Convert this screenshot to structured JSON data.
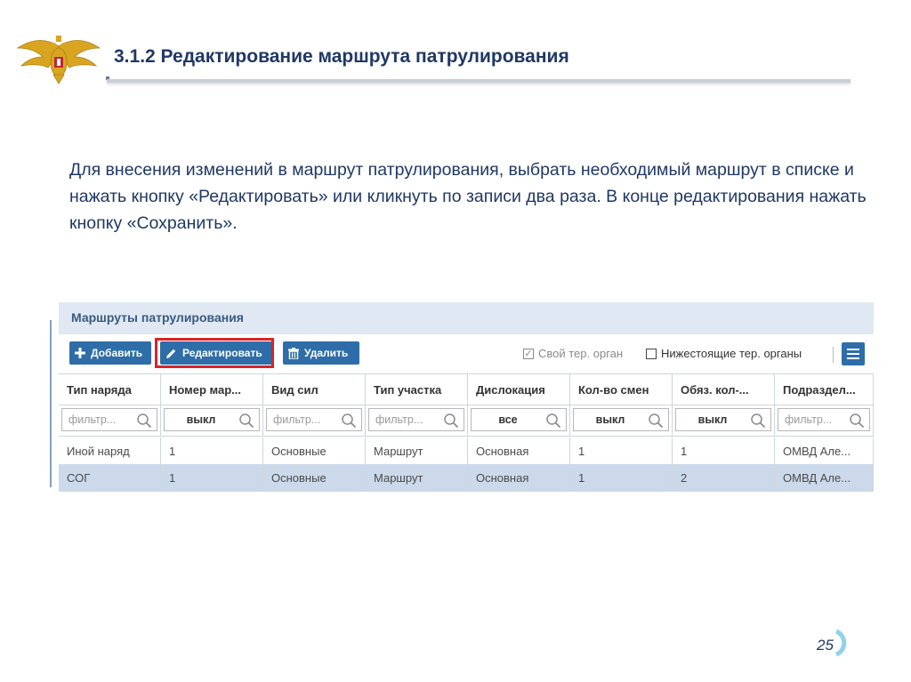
{
  "slide": {
    "title": "3.1.2 Редактирование маршрута патрулирования",
    "paragraph": "Для внесения изменений в маршрут патрулирования, выбрать необходимый маршрут в списке и нажать кнопку «Редактировать» или кликнуть по записи два раза. В конце редактирования нажать кнопку «Сохранить».",
    "page_number": "25",
    "emblem_icon": "double-headed-eagle-icon"
  },
  "app": {
    "panel_title": "Маршруты патрулирования",
    "toolbar": {
      "add_label": "Добавить",
      "edit_label": "Редактировать",
      "delete_label": "Удалить",
      "own_org_label": "Свой тер. орган",
      "own_org_checked": true,
      "sub_orgs_label": "Нижестоящие тер. органы",
      "sub_orgs_checked": false
    },
    "columns": [
      "Тип наряда",
      "Номер мар...",
      "Вид сил",
      "Тип участка",
      "Дислокация",
      "Кол-во смен",
      "Обяз. кол-...",
      "Подраздел..."
    ],
    "filters": [
      {
        "text": "фильтр...",
        "selected": false
      },
      {
        "text": "выкл",
        "selected": true
      },
      {
        "text": "фильтр...",
        "selected": false
      },
      {
        "text": "фильтр...",
        "selected": false
      },
      {
        "text": "все",
        "selected": true
      },
      {
        "text": "выкл",
        "selected": true
      },
      {
        "text": "выкл",
        "selected": true
      },
      {
        "text": "фильтр...",
        "selected": false
      }
    ],
    "rows": [
      [
        "Иной наряд",
        "1",
        "Основные",
        "Маршрут",
        "Основная",
        "1",
        "1",
        "ОМВД Але..."
      ],
      [
        "СОГ",
        "1",
        "Основные",
        "Маршрут",
        "Основная",
        "1",
        "2",
        "ОМВД Але..."
      ]
    ],
    "selected_row": 1,
    "colors": {
      "accent": "#2e6da8",
      "highlight_border": "#d8232a",
      "selected_row": "#cbd9ea",
      "panel_header": "#dfe8f3"
    }
  }
}
